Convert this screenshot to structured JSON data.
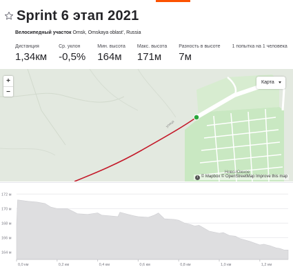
{
  "header": {
    "title": "Sprint 6 этап 2021"
  },
  "segment": {
    "type_label": "Велосипедный участок",
    "location": "Omsk, Omskaya oblast', Russia"
  },
  "stats": [
    {
      "label": "Дистанция",
      "value": "1,34км"
    },
    {
      "label": "Ср. уклон",
      "value": "-0,5%"
    },
    {
      "label": "Мин. высота",
      "value": "164м"
    },
    {
      "label": "Макс. высота",
      "value": "171м"
    },
    {
      "label": "Разность в высоте",
      "value": "7м"
    },
    {
      "label": "1 попытка на 1 человека",
      "value": ""
    }
  ],
  "map": {
    "zoom_in": "+",
    "zoom_out": "−",
    "layer_select": "Карта",
    "attribution": "© Mapbox © OpenStreetMap Improve this map",
    "place_label": "Ново-Южное",
    "road_label": "улица"
  },
  "colors": {
    "accent": "#fc5200",
    "route": "#c41a2a",
    "end_marker": "#2aa63c",
    "profile_fill": "#dedee0",
    "map_green": "#c9e8c2"
  },
  "chart_data": {
    "type": "area",
    "title": "",
    "xlabel": "",
    "ylabel": "",
    "ylim": [
      163,
      172.5
    ],
    "xlim": [
      0,
      1.34
    ],
    "y_ticks": [
      164,
      166,
      168,
      170,
      172
    ],
    "y_tick_labels": [
      "164 м",
      "166 м",
      "168 м",
      "170 м",
      "172 м"
    ],
    "x_ticks": [
      0,
      0.2,
      0.4,
      0.6,
      0.8,
      1.0,
      1.2
    ],
    "x_tick_labels": [
      "0,0 км",
      "0,2 км",
      "0,4 км",
      "0,6 км",
      "0,8 км",
      "1,0 км",
      "1,2 км"
    ],
    "grid": true,
    "series": [
      {
        "x": [
          0,
          0.005,
          0.03,
          0.06,
          0.1,
          0.14,
          0.17,
          0.2,
          0.25,
          0.28,
          0.3,
          0.35,
          0.4,
          0.42,
          0.46,
          0.5,
          0.51,
          0.55,
          0.58,
          0.6,
          0.65,
          0.68,
          0.7,
          0.73,
          0.78,
          0.8,
          0.83,
          0.86,
          0.88,
          0.9,
          0.92,
          0.95,
          1.0,
          1.02,
          1.05,
          1.08,
          1.1,
          1.15,
          1.2,
          1.22,
          1.25,
          1.28,
          1.3,
          1.32,
          1.34
        ],
        "y": [
          167.8,
          171.2,
          171.1,
          171.0,
          170.9,
          170.7,
          170.2,
          170.0,
          170.0,
          169.6,
          169.3,
          169.2,
          169.4,
          169.1,
          169.0,
          168.9,
          169.5,
          169.2,
          169.0,
          168.9,
          168.8,
          169.1,
          169.4,
          168.6,
          168.5,
          168.4,
          168.0,
          167.8,
          167.6,
          167.7,
          167.4,
          166.9,
          166.6,
          166.7,
          166.3,
          166.2,
          165.9,
          165.5,
          165.0,
          165.1,
          164.9,
          164.6,
          164.5,
          164.3,
          164.3
        ]
      }
    ]
  }
}
